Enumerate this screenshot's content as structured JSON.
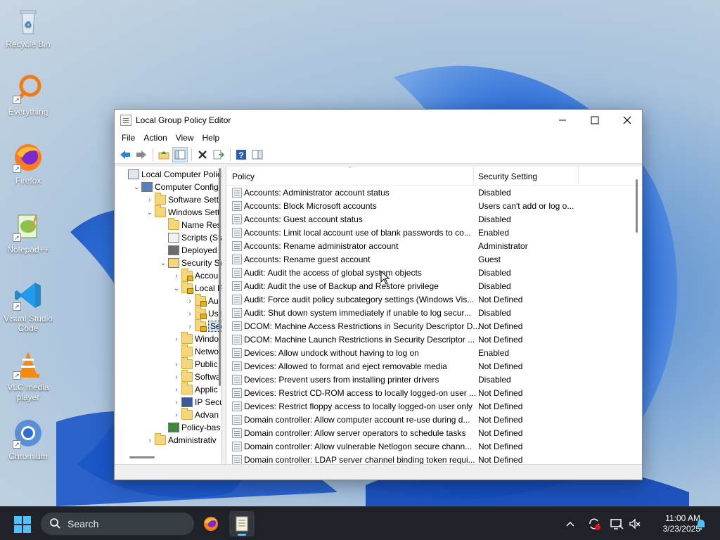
{
  "desktop": {
    "icons": [
      {
        "label": "Recycle Bin"
      },
      {
        "label": "Everything"
      },
      {
        "label": "Firefox"
      },
      {
        "label": "Notepad++"
      },
      {
        "label": "Visual Studio Code"
      },
      {
        "label": "VLC media player"
      },
      {
        "label": "Chromium"
      }
    ]
  },
  "window": {
    "title": "Local Group Policy Editor",
    "controls": {
      "minimize": "—",
      "maximize": "☐",
      "close": "✕"
    },
    "menu": [
      "File",
      "Action",
      "View",
      "Help"
    ]
  },
  "tree": [
    {
      "label": "Local Computer Polic",
      "expander": "",
      "indent": 0,
      "icon": "computer-policy"
    },
    {
      "label": "Computer Config",
      "expander": "⌄",
      "indent": 1,
      "icon": "computer"
    },
    {
      "label": "Software Setti",
      "expander": "›",
      "indent": 2,
      "icon": "folder"
    },
    {
      "label": "Windows Sett",
      "expander": "⌄",
      "indent": 2,
      "icon": "folder"
    },
    {
      "label": "Name Res",
      "expander": "",
      "indent": 3,
      "icon": "folder"
    },
    {
      "label": "Scripts (Sta",
      "expander": "",
      "indent": 3,
      "icon": "scripts"
    },
    {
      "label": "Deployed",
      "expander": "",
      "indent": 3,
      "icon": "printer"
    },
    {
      "label": "Security Se",
      "expander": "⌄",
      "indent": 3,
      "icon": "security"
    },
    {
      "label": "Accou",
      "expander": "›",
      "indent": 4,
      "icon": "lock-folder"
    },
    {
      "label": "Local P",
      "expander": "⌄",
      "indent": 4,
      "icon": "lock-folder"
    },
    {
      "label": "Au",
      "expander": "›",
      "indent": 5,
      "icon": "lock-folder"
    },
    {
      "label": "Use",
      "expander": "›",
      "indent": 5,
      "icon": "lock-folder"
    },
    {
      "label": "Sec",
      "expander": "›",
      "indent": 5,
      "icon": "lock-folder",
      "selected": true
    },
    {
      "label": "Windo",
      "expander": "›",
      "indent": 4,
      "icon": "folder"
    },
    {
      "label": "Netwo",
      "expander": "",
      "indent": 4,
      "icon": "folder"
    },
    {
      "label": "Public",
      "expander": "›",
      "indent": 4,
      "icon": "folder"
    },
    {
      "label": "Softwa",
      "expander": "›",
      "indent": 4,
      "icon": "folder"
    },
    {
      "label": "Applic",
      "expander": "›",
      "indent": 4,
      "icon": "folder"
    },
    {
      "label": "IP Secu",
      "expander": "›",
      "indent": 4,
      "icon": "ipsec"
    },
    {
      "label": "Advan",
      "expander": "›",
      "indent": 4,
      "icon": "folder"
    },
    {
      "label": "Policy-bas",
      "expander": "",
      "indent": 3,
      "icon": "chart"
    },
    {
      "label": "Administrativ",
      "expander": "›",
      "indent": 2,
      "icon": "folder"
    }
  ],
  "list": {
    "columns": {
      "policy": "Policy",
      "setting": "Security Setting"
    },
    "rows": [
      {
        "policy": "Accounts: Administrator account status",
        "setting": "Disabled"
      },
      {
        "policy": "Accounts: Block Microsoft accounts",
        "setting": "Users can't add or log o..."
      },
      {
        "policy": "Accounts: Guest account status",
        "setting": "Disabled"
      },
      {
        "policy": "Accounts: Limit local account use of blank passwords to co...",
        "setting": "Enabled"
      },
      {
        "policy": "Accounts: Rename administrator account",
        "setting": "Administrator"
      },
      {
        "policy": "Accounts: Rename guest account",
        "setting": "Guest"
      },
      {
        "policy": "Audit: Audit the access of global system objects",
        "setting": "Disabled"
      },
      {
        "policy": "Audit: Audit the use of Backup and Restore privilege",
        "setting": "Disabled"
      },
      {
        "policy": "Audit: Force audit policy subcategory settings (Windows Vis...",
        "setting": "Not Defined"
      },
      {
        "policy": "Audit: Shut down system immediately if unable to log secur...",
        "setting": "Disabled"
      },
      {
        "policy": "DCOM: Machine Access Restrictions in Security Descriptor D...",
        "setting": "Not Defined"
      },
      {
        "policy": "DCOM: Machine Launch Restrictions in Security Descriptor ...",
        "setting": "Not Defined"
      },
      {
        "policy": "Devices: Allow undock without having to log on",
        "setting": "Enabled"
      },
      {
        "policy": "Devices: Allowed to format and eject removable media",
        "setting": "Not Defined"
      },
      {
        "policy": "Devices: Prevent users from installing printer drivers",
        "setting": "Disabled"
      },
      {
        "policy": "Devices: Restrict CD-ROM access to locally logged-on user ...",
        "setting": "Not Defined"
      },
      {
        "policy": "Devices: Restrict floppy access to locally logged-on user only",
        "setting": "Not Defined"
      },
      {
        "policy": "Domain controller: Allow computer account re-use during d...",
        "setting": "Not Defined"
      },
      {
        "policy": "Domain controller: Allow server operators to schedule tasks",
        "setting": "Not Defined"
      },
      {
        "policy": "Domain controller: Allow vulnerable Netlogon secure chann...",
        "setting": "Not Defined"
      },
      {
        "policy": "Domain controller: LDAP server channel binding token requi...",
        "setting": "Not Defined"
      }
    ]
  },
  "taskbar": {
    "search_placeholder": "Search",
    "time": "11:00 AM",
    "date": "3/23/2025"
  },
  "colors": {
    "accent": "#4cc2ff",
    "taskbar_bg": "#1f2329",
    "selection": "#cce4f7"
  }
}
